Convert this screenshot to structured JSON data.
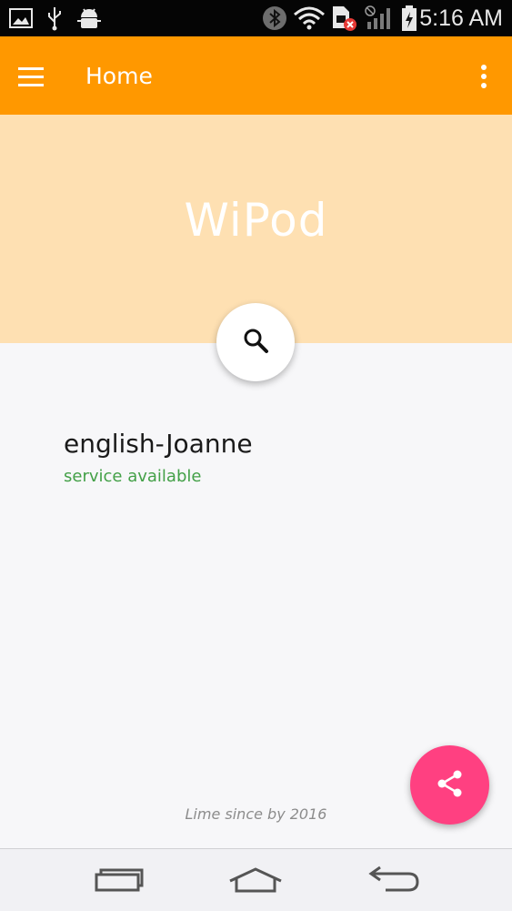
{
  "status_bar": {
    "time": "5:16 AM",
    "icons": [
      "image-icon",
      "usb-icon",
      "android-debug-icon",
      "bluetooth-icon",
      "wifi-icon",
      "sim-error-icon",
      "signal-icon",
      "battery-charging-icon"
    ]
  },
  "app_bar": {
    "title": "Home",
    "menu_icon": "hamburger-menu-icon",
    "overflow_icon": "more-vert-icon"
  },
  "hero": {
    "brand": "WiPod",
    "search_icon": "search-icon"
  },
  "service": {
    "name": "english-Joanne",
    "status": "service available"
  },
  "footer": {
    "text": "Lime since by 2016"
  },
  "share_fab": {
    "icon": "share-icon"
  },
  "nav_bar": {
    "buttons": [
      "recent-apps-icon",
      "home-icon",
      "back-icon"
    ]
  },
  "colors": {
    "app_bar": "#ff9800",
    "hero": "#fee0b2",
    "status_ok": "#43a047",
    "share_fab": "#ff4081",
    "background": "#f7f7f9"
  }
}
